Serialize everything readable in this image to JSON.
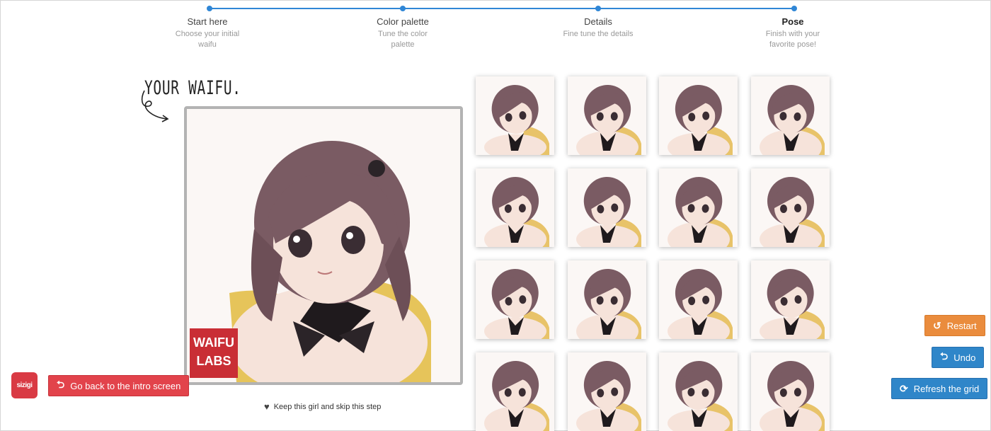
{
  "stepper": {
    "steps": [
      {
        "title": "Start here",
        "subtitle_lines": [
          "Choose your initial",
          "waifu"
        ]
      },
      {
        "title": "Color palette",
        "subtitle_lines": [
          "Tune the color",
          "palette"
        ]
      },
      {
        "title": "Details",
        "subtitle_lines": [
          "Fine tune the details"
        ]
      },
      {
        "title": "Pose",
        "subtitle_lines": [
          "Finish with your",
          "favorite pose!"
        ]
      }
    ],
    "active_index": 3,
    "accent_color": "#2f86d6"
  },
  "caption": "YOUR WAIFU.",
  "portrait": {
    "watermark_lines": [
      "WAIFU",
      "LABS"
    ],
    "hair_color": "#7a5b63",
    "skin_color": "#f6e3da",
    "accent_color": "#e2b13a"
  },
  "keep_link": {
    "icon": "heart-icon",
    "label": "Keep this girl and skip this step"
  },
  "buttons": {
    "back": {
      "label": "Go back to the intro screen",
      "icon": "undo-arrow-icon",
      "color": "#e2434b"
    },
    "restart": {
      "label": "Restart",
      "icon": "restart-icon",
      "color": "#ea8c3d"
    },
    "undo": {
      "label": "Undo",
      "icon": "undo-arrow-icon",
      "color": "#2f86c9"
    },
    "refresh": {
      "label": "Refresh the grid",
      "icon": "refresh-icon",
      "color": "#2f86c9"
    }
  },
  "logo": {
    "text": "sizigi"
  },
  "grid": {
    "rows": 4,
    "columns": 4,
    "variations": 16
  }
}
